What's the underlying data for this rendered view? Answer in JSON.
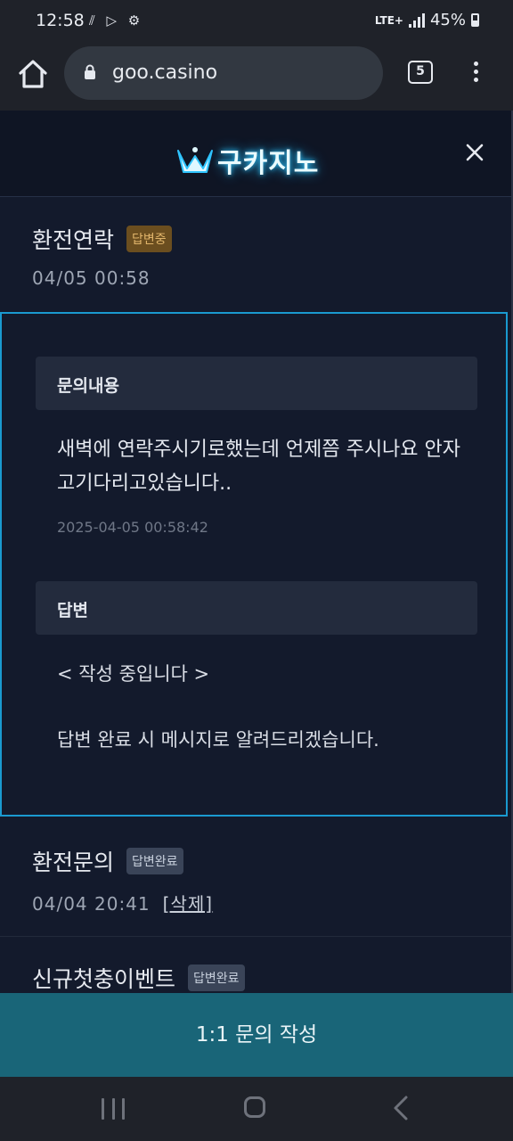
{
  "status_bar": {
    "time": "12:58",
    "network": "LTE+",
    "battery": "45%",
    "left_icons": "⫽ ▷ ⚙"
  },
  "browser": {
    "url": "goo.casino",
    "tab_count": "5"
  },
  "modal": {
    "logo_text": "구카지노",
    "current": {
      "title": "환전연락",
      "badge": "답변중",
      "date": "04/05 00:58"
    },
    "detail": {
      "question_header": "문의내용",
      "question_body": "새벽에 연락주시기로했는데 언제쯤 주시나요 안자고기다리고있습니다..",
      "question_time": "2025-04-05 00:58:42",
      "answer_header": "답변",
      "answer_status": "< 작성 중입니다 >",
      "answer_note": "답변 완료 시 메시지로 알려드리겠습니다."
    },
    "list": [
      {
        "title": "환전문의",
        "badge": "답변완료",
        "date": "04/04 20:41",
        "delete": "[삭제]"
      },
      {
        "title": "신규첫충이벤트",
        "badge": "답변완료"
      }
    ]
  },
  "write_button": "1:1 문의 작성",
  "colors": {
    "accent": "#1a9ad0",
    "cta": "#196578",
    "pending_badge": "#6b4e1f"
  }
}
